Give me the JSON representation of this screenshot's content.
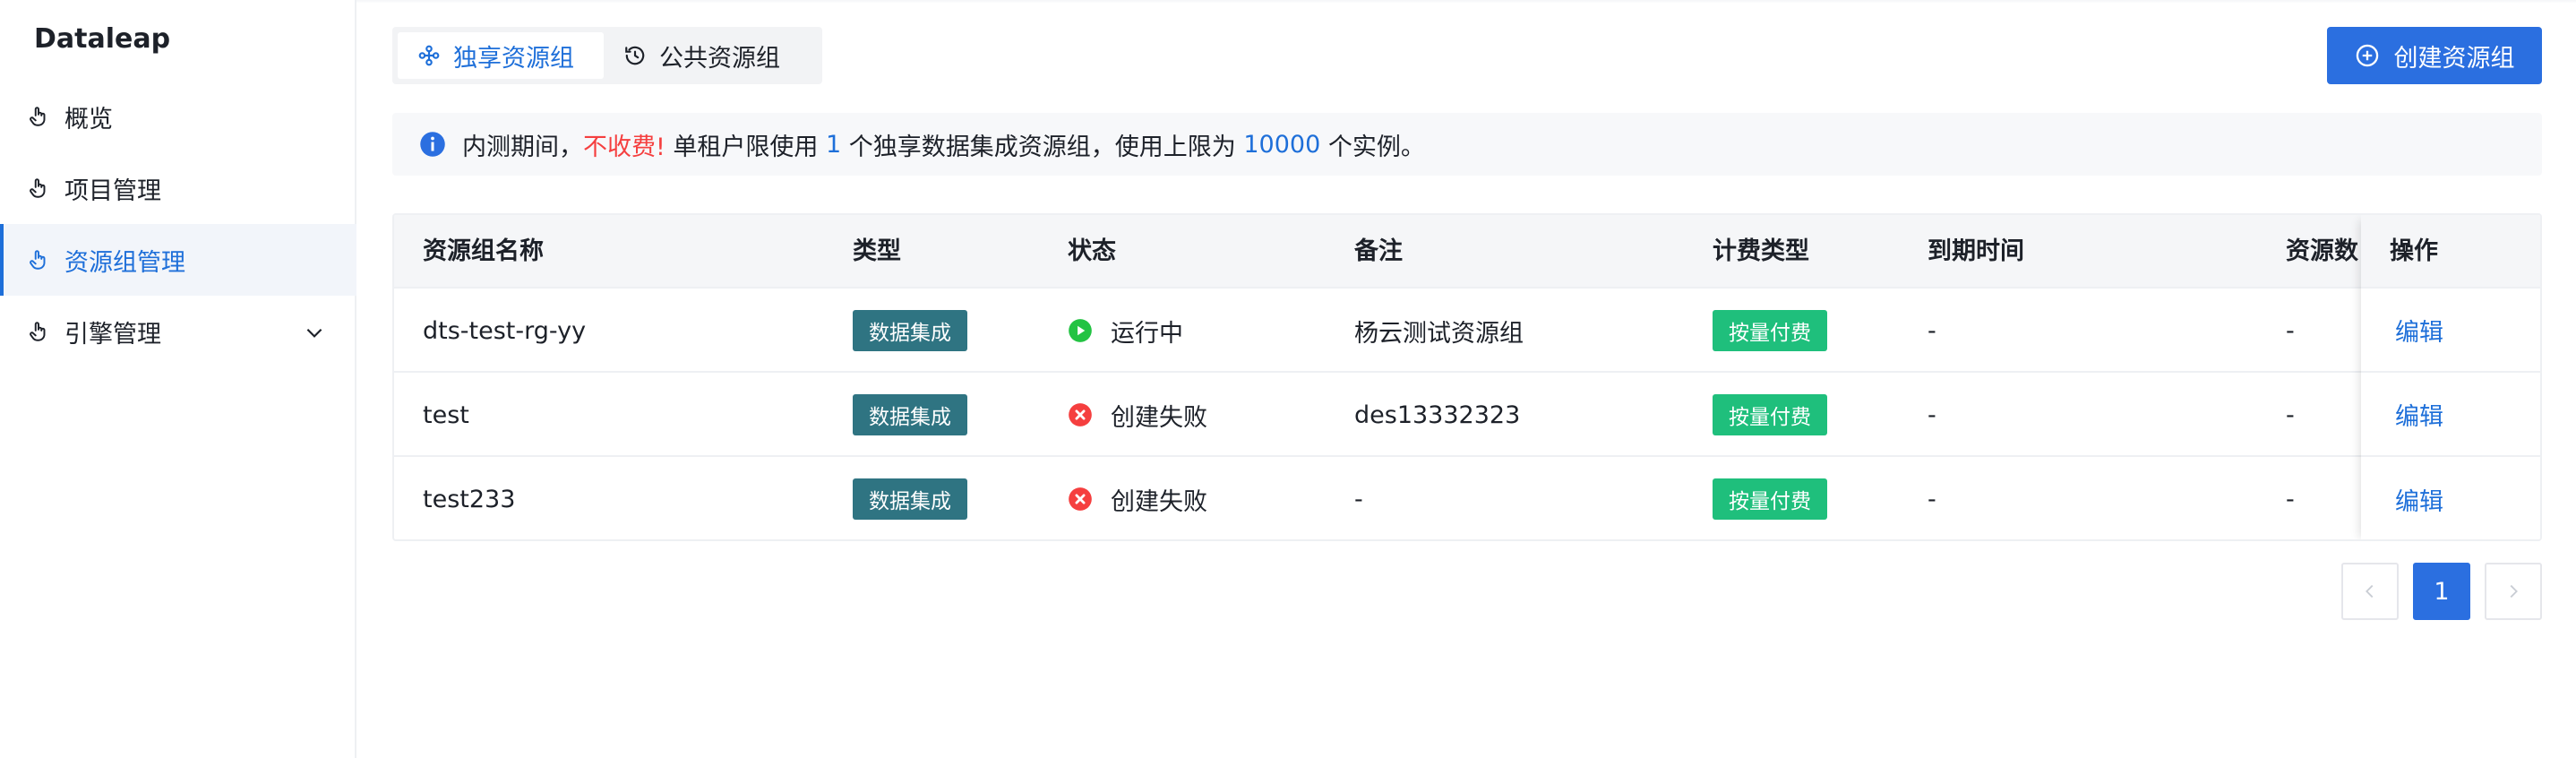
{
  "app": {
    "brand": "Dataleap"
  },
  "sidebar": {
    "items": [
      {
        "label": "概览",
        "icon": "hand-pointer-icon"
      },
      {
        "label": "项目管理",
        "icon": "hand-pointer-icon"
      },
      {
        "label": "资源组管理",
        "icon": "hand-pointer-icon",
        "active": true
      },
      {
        "label": "引擎管理",
        "icon": "hand-pointer-icon",
        "expandable": true
      }
    ]
  },
  "tabs": [
    {
      "label": "独享资源组",
      "icon": "cluster-icon",
      "active": true
    },
    {
      "label": "公共资源组",
      "icon": "history-icon",
      "active": false
    }
  ],
  "toolbar": {
    "create_label": "创建资源组",
    "create_icon": "plus-circle-icon"
  },
  "notice": {
    "prefix": "内测期间，",
    "free": "不收费!",
    "mid1": " 单租户限使用 ",
    "limit_groups": "1",
    "mid2": " 个独享数据集成资源组，使用上限为 ",
    "limit_instances": "10000",
    "suffix": " 个实例。"
  },
  "table": {
    "columns": [
      "资源组名称",
      "类型",
      "状态",
      "备注",
      "计费类型",
      "到期时间",
      "资源数",
      "操作"
    ],
    "rows": [
      {
        "name": "dts-test-rg-yy",
        "type": "数据集成",
        "status": "运行中",
        "status_kind": "running",
        "remark": "杨云测试资源组",
        "billing": "按量付费",
        "expire": "-",
        "resources": "-",
        "action": "编辑"
      },
      {
        "name": "test",
        "type": "数据集成",
        "status": "创建失败",
        "status_kind": "failed",
        "remark": "des13332323",
        "billing": "按量付费",
        "expire": "-",
        "resources": "-",
        "action": "编辑"
      },
      {
        "name": "test233",
        "type": "数据集成",
        "status": "创建失败",
        "status_kind": "failed",
        "remark": "-",
        "billing": "按量付费",
        "expire": "-",
        "resources": "-",
        "action": "编辑"
      }
    ]
  },
  "pagination": {
    "current": "1"
  },
  "colors": {
    "accent": "#2b6fe0",
    "running": "#23c343",
    "failed": "#f53f3f",
    "tag_type": "#2f7482",
    "tag_billing": "#1fbf7c"
  }
}
